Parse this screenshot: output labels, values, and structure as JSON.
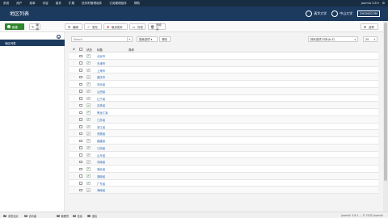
{
  "topnav": {
    "menu": [
      "系统",
      "用户",
      "菜单",
      "内容",
      "组件",
      "扩展",
      "信件附管理组件",
      "订阅管理组件",
      "帮助"
    ],
    "right_text": "Joomla 3.8 ▾",
    "gear": "⚙"
  },
  "header": {
    "title": "地区列表",
    "logo1": "清华大学",
    "logo2": "中山大学",
    "logo3": "ZHONGCOM"
  },
  "toolbar": {
    "new": "新建",
    "edit": "编辑",
    "publish": "发布",
    "unpublish": "取消发布",
    "archive": "存档",
    "trash": "回收站",
    "options": "选项",
    "edit_short": "编辑"
  },
  "sidebar": {
    "collapse": "◂",
    "item": "地区列表"
  },
  "filters": {
    "search_placeholder": "Search",
    "search_icon": "⌕",
    "options": "搜索选项 ▾",
    "clear": "清除",
    "sort": "排序选项-升序(A-Z)",
    "limit": "20"
  },
  "table": {
    "headers": [
      "#",
      "",
      "状态",
      "标题",
      "简称"
    ],
    "rows": [
      "北京市",
      "天津市",
      "上海市",
      "重庆市",
      "河北省",
      "山西省",
      "辽宁省",
      "吉林省",
      "黑龙江省",
      "江苏省",
      "浙江省",
      "安徽省",
      "福建省",
      "江西省",
      "山东省",
      "河南省",
      "湖北省",
      "湖南省",
      "广东省",
      "海南省"
    ]
  },
  "statusbar": {
    "view_site": "浏览站点",
    "visitors_count": "0",
    "visitors": "访问者",
    "admins_count": "1",
    "admins": "管理员",
    "messages_count": "0",
    "messages": "信息",
    "logout": "退出",
    "version": "Joomla! 3.8.1 — © 2020 Joomla!"
  }
}
